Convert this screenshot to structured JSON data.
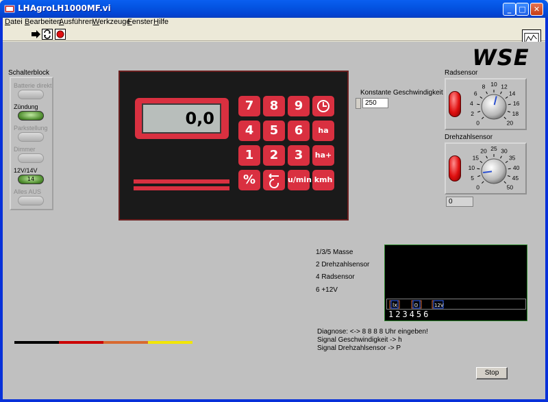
{
  "window": {
    "title": "LHAgroLH1000MF.vi"
  },
  "menu": [
    {
      "label": "Datei",
      "accel": "D"
    },
    {
      "label": "Bearbeiten",
      "accel": "B"
    },
    {
      "label": "Ausführen",
      "accel": "A"
    },
    {
      "label": "Werkzeuge",
      "accel": "W"
    },
    {
      "label": "Fenster",
      "accel": "F"
    },
    {
      "label": "Hilfe",
      "accel": "H"
    }
  ],
  "toolbar": {
    "icons": [
      "run-arrow-icon",
      "run-continuous-icon",
      "abort-icon"
    ]
  },
  "logo": {
    "text": "WSE"
  },
  "switch_block": {
    "title": "Schalterblock",
    "switches": [
      {
        "label": "Batterie direkt",
        "state": "off",
        "enabled": false
      },
      {
        "label": "Zündung",
        "state": "on",
        "enabled": true
      },
      {
        "label": "Parkstellung",
        "state": "off",
        "enabled": false
      },
      {
        "label": "Dimmer",
        "state": "off",
        "enabled": false
      },
      {
        "label": "12V/14V",
        "state": "on",
        "enabled": true,
        "button_text": "14"
      },
      {
        "label": "Alles AUS",
        "state": "off",
        "enabled": false
      }
    ]
  },
  "device": {
    "display_value": "0,0",
    "keys": [
      "7",
      "8",
      "9",
      "clock",
      "4",
      "5",
      "6",
      "ha",
      "1",
      "2",
      "3",
      "ha+",
      "%",
      "reset",
      "u/min",
      "kmh"
    ]
  },
  "speed": {
    "label": "Konstante Geschwindigkeit",
    "value": "250"
  },
  "radsensor": {
    "label": "Radsensor",
    "scale_ticks": [
      "0",
      "2",
      "4",
      "6",
      "8",
      "10",
      "12",
      "14",
      "16",
      "18",
      "20"
    ],
    "value": 11
  },
  "drehzahlsensor": {
    "label": "Drehzahlsensor",
    "scale_ticks": [
      "0",
      "5",
      "10",
      "15",
      "20",
      "25",
      "30",
      "35",
      "40",
      "45",
      "50"
    ],
    "value": 7,
    "readout": "0"
  },
  "pinout": [
    "1/3/5 Masse",
    "2 Drehzahlsensor",
    "4 Radsensor",
    "6 +12V"
  ],
  "connector": {
    "slot_labels": [
      "lx",
      "⊙",
      "12V"
    ],
    "pin_numbers": "123456"
  },
  "diagnostics": [
    "Diagnose: <-> 8 8 8 8 Uhr eingeben!",
    "Signal Geschwindigkeit -> h",
    "Signal Drehzahlsensor -> P"
  ],
  "colors": {
    "bar": [
      "#000000",
      "#CC0000",
      "#D86A30",
      "#F2E600"
    ]
  },
  "stop_button": {
    "label": "Stop"
  }
}
